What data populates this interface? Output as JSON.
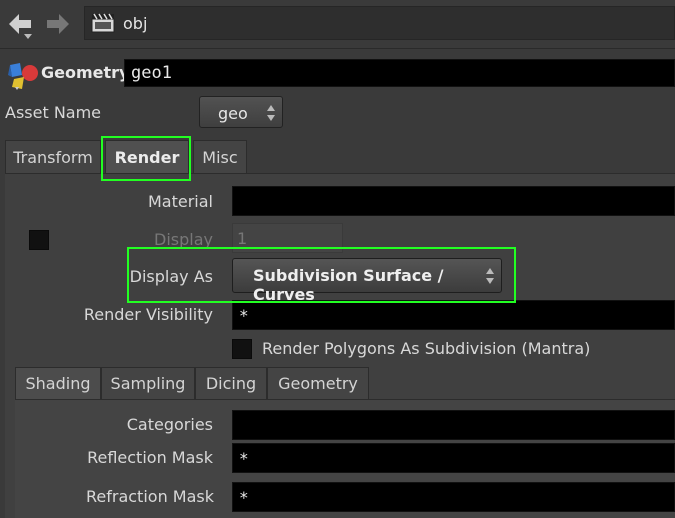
{
  "path": {
    "text": "obj"
  },
  "node": {
    "type": "Geometry",
    "name": "geo1"
  },
  "asset": {
    "label": "Asset Name",
    "value": "geo"
  },
  "main_tabs": [
    {
      "label": "Transform"
    },
    {
      "label": "Render",
      "active": true
    },
    {
      "label": "Misc"
    }
  ],
  "render": {
    "material_label": "Material",
    "material_value": "",
    "display_label": "Display",
    "display_value": "1",
    "display_as_label": "Display As",
    "display_as_value": "Subdivision Surface / Curves",
    "render_visibility_label": "Render Visibility",
    "render_visibility_value": "*",
    "render_polygons_label": "Render Polygons As Subdivision (Mantra)"
  },
  "sub_tabs": [
    {
      "label": "Shading",
      "active": true
    },
    {
      "label": "Sampling"
    },
    {
      "label": "Dicing"
    },
    {
      "label": "Geometry"
    }
  ],
  "shading": {
    "categories_label": "Categories",
    "categories_value": "",
    "reflection_mask_label": "Reflection Mask",
    "reflection_mask_value": "*",
    "refraction_mask_label": "Refraction Mask",
    "refraction_mask_value": "*"
  },
  "colors": {
    "highlight": "#22ff22",
    "background": "#3a3a3a",
    "field": "#000000"
  }
}
